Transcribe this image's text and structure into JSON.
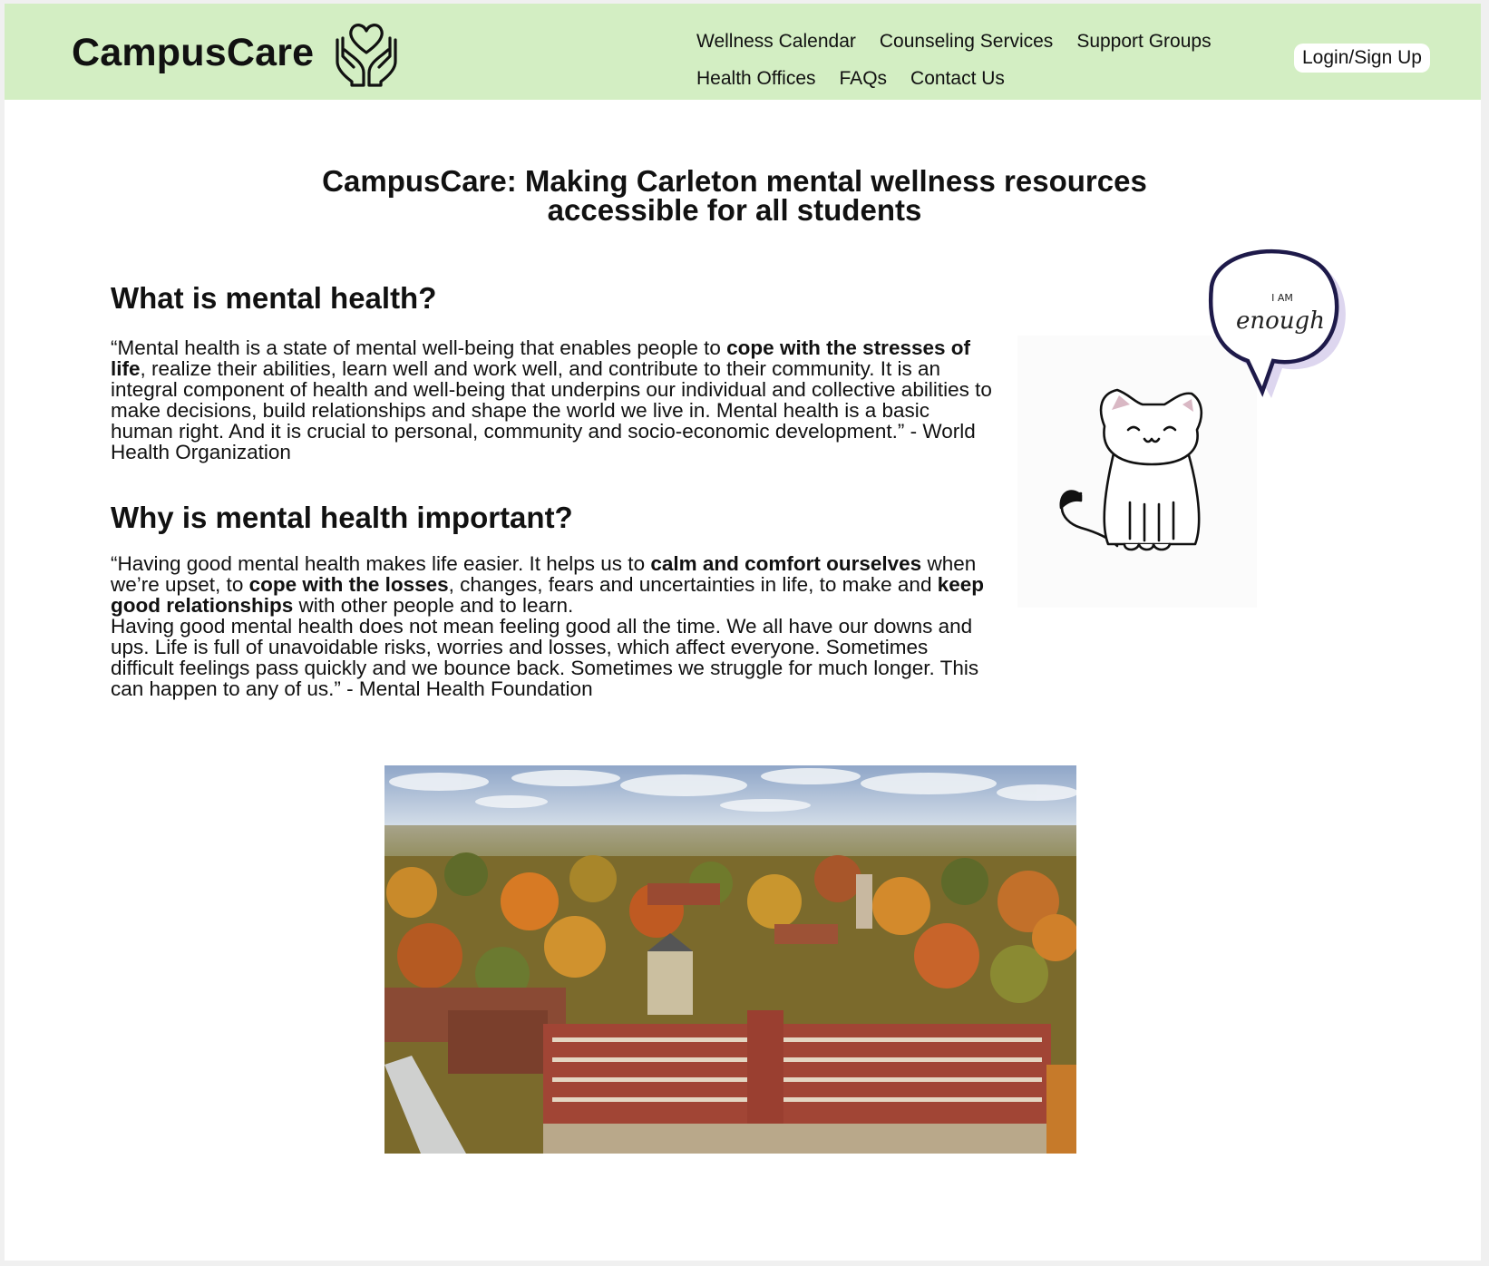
{
  "header": {
    "brand": "CampusCare",
    "nav_row1": [
      "Wellness Calendar",
      "Counseling Services",
      "Support Groups"
    ],
    "nav_row2": [
      "Health Offices",
      "FAQs",
      "Contact Us"
    ],
    "login": "Login/Sign Up",
    "logo_icon": "heart-in-hands-icon"
  },
  "hero": {
    "title_line1": "CampusCare: Making Carleton mental wellness resources",
    "title_line2": "accessible for all students"
  },
  "section1": {
    "heading": "What is mental health?",
    "p_a": "“Mental health is a state of mental well-being that enables people to ",
    "p_b": "cope with the stresses of life",
    "p_c": ", realize their abilities, learn well and work well, and contribute to their community. It is an integral component of health and well-being that underpins our individual and collective abilities to make decisions, build relationships and shape the world we live in. Mental health is a basic human right. And it is crucial to personal, community and socio-economic development.” - World Health Organization"
  },
  "section2": {
    "heading": "Why is mental health important?",
    "p_a": "“Having good mental health makes life easier. It helps us to ",
    "p_b": "calm and comfort ourselves",
    "p_c": " when we’re upset, to ",
    "p_d": "cope with the losses",
    "p_e": ", changes, fears and uncertainties in life, to make and ",
    "p_f": "keep good relationships",
    "p_g": " with other people and to learn.",
    "p_h": "Having good mental health does not mean feeling good all the time. We all have our downs and ups. Life is full of unavoidable risks, worries and losses, which affect everyone. Sometimes difficult feelings pass quickly and we bounce back. Sometimes we struggle for much longer. This can happen to any of us.” - Mental Health Foundation"
  },
  "illustration": {
    "bubble_line1": "I  AM",
    "bubble_line2": "enough",
    "icon": "cat-illustration"
  },
  "photo": {
    "icon": "campus-aerial-photo"
  },
  "colors": {
    "header_bg": "#d3eec3",
    "bubble_fill": "#ddd6ef",
    "bubble_stroke": "#1e1a4a"
  }
}
